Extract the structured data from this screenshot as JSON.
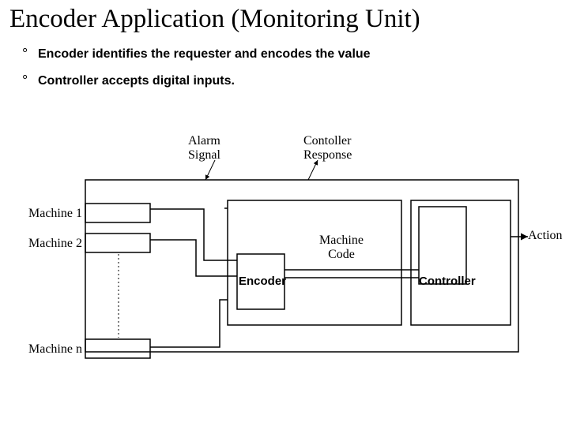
{
  "title": "Encoder Application (Monitoring Unit)",
  "bullets": [
    "Encoder identifies the requester and encodes the value",
    "Controller accepts digital inputs."
  ],
  "labels": {
    "alarm_signal_l1": "Alarm",
    "alarm_signal_l2": "Signal",
    "controller_response_l1": "Contoller",
    "controller_response_l2": "Response",
    "machine1": "Machine 1",
    "machine2": "Machine 2",
    "machinen": "Machine n",
    "machine_code_l1": "Machine",
    "machine_code_l2": "Code",
    "encoder": "Encoder",
    "controller": "Controller",
    "action": "Action"
  }
}
